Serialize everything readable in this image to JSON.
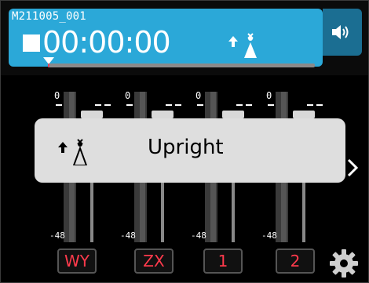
{
  "header": {
    "file_name": "M211005_001",
    "elapsed": "00:00:00",
    "position_fraction": 0.0,
    "mode_icon": "upright-mic-icon",
    "speaker_icon": "speaker-icon",
    "accent": "#2ba8d8"
  },
  "meters": {
    "channels": [
      {
        "top_label": "0",
        "bottom_label": "-48"
      },
      {
        "top_label": "0",
        "bottom_label": "-48"
      },
      {
        "top_label": "0",
        "bottom_label": "-48"
      },
      {
        "top_label": "0",
        "bottom_label": "-48"
      }
    ]
  },
  "popup": {
    "icon": "upright-mic-icon",
    "label": "Upright"
  },
  "channel_buttons": [
    {
      "label": "WY"
    },
    {
      "label": "ZX"
    },
    {
      "label": "1"
    },
    {
      "label": "2"
    }
  ],
  "settings_icon": "gear-icon",
  "colors": {
    "channel_label": "#ff3a4c",
    "popup_bg": "#dedede"
  }
}
